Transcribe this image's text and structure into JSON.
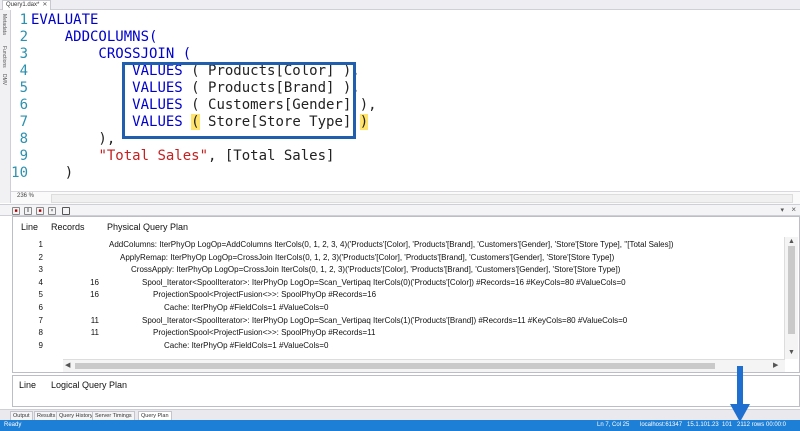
{
  "tab": {
    "title": "Query1.dax*",
    "close": "✕"
  },
  "rail": {
    "labels": [
      "Metadata",
      "Functions",
      "DMV"
    ]
  },
  "editor": {
    "zoom": "236 %",
    "lines": [
      {
        "n": "1",
        "parts": [
          {
            "t": "EVALUATE",
            "c": "kw"
          }
        ]
      },
      {
        "n": "2",
        "parts": [
          {
            "t": "    ADDCOLUMNS(",
            "c": "fn"
          }
        ]
      },
      {
        "n": "3",
        "parts": [
          {
            "t": "        CROSSJOIN (",
            "c": "fn"
          }
        ]
      },
      {
        "n": "4",
        "parts": [
          {
            "t": "            ",
            "c": "tx"
          },
          {
            "t": "VALUES",
            "c": "fn"
          },
          {
            "t": " ( Products[Color] ),",
            "c": "tx"
          }
        ]
      },
      {
        "n": "5",
        "parts": [
          {
            "t": "            ",
            "c": "tx"
          },
          {
            "t": "VALUES",
            "c": "fn"
          },
          {
            "t": " ( Products[Brand] ),",
            "c": "tx"
          }
        ]
      },
      {
        "n": "6",
        "parts": [
          {
            "t": "            ",
            "c": "tx"
          },
          {
            "t": "VALUES",
            "c": "fn"
          },
          {
            "t": " ( Customers[Gender] ),",
            "c": "tx"
          }
        ]
      },
      {
        "n": "7",
        "parts": [
          {
            "t": "            ",
            "c": "tx"
          },
          {
            "t": "VALUES",
            "c": "fn"
          },
          {
            "t": " ",
            "c": "tx"
          },
          {
            "t": "(",
            "c": "tx hl"
          },
          {
            "t": " Store[Store Type] ",
            "c": "tx"
          },
          {
            "t": ")",
            "c": "tx hl"
          }
        ]
      },
      {
        "n": "8",
        "parts": [
          {
            "t": "        ),",
            "c": "tx"
          }
        ]
      },
      {
        "n": "9",
        "parts": [
          {
            "t": "        ",
            "c": "tx"
          },
          {
            "t": "\"Total Sales\"",
            "c": "str"
          },
          {
            "t": ", [Total Sales]",
            "c": "tx"
          }
        ]
      },
      {
        "n": "10",
        "parts": [
          {
            "t": "    )",
            "c": "tx"
          }
        ]
      }
    ]
  },
  "physical_plan": {
    "headers": {
      "line": "Line",
      "records": "Records",
      "plan": "Physical Query Plan"
    },
    "rows": [
      {
        "line": "1",
        "records": "",
        "indent": 0,
        "op": "AddColumns: IterPhyOp LogOp=AddColumns IterCols(0, 1, 2, 3, 4)('Products'[Color], 'Products'[Brand], 'Customers'[Gender], 'Store'[Store Type], ''[Total Sales])"
      },
      {
        "line": "2",
        "records": "",
        "indent": 1,
        "op": "ApplyRemap: IterPhyOp LogOp=CrossJoin IterCols(0, 1, 2, 3)('Products'[Color], 'Products'[Brand], 'Customers'[Gender], 'Store'[Store Type])"
      },
      {
        "line": "3",
        "records": "",
        "indent": 2,
        "op": "CrossApply: IterPhyOp LogOp=CrossJoin IterCols(0, 1, 2, 3)('Products'[Color], 'Products'[Brand], 'Customers'[Gender], 'Store'[Store Type])"
      },
      {
        "line": "4",
        "records": "16",
        "indent": 3,
        "op": "Spool_Iterator<SpoolIterator>: IterPhyOp LogOp=Scan_Vertipaq IterCols(0)('Products'[Color]) #Records=16 #KeyCols=80 #ValueCols=0"
      },
      {
        "line": "5",
        "records": "16",
        "indent": 4,
        "op": "ProjectionSpool<ProjectFusion<>>: SpoolPhyOp #Records=16"
      },
      {
        "line": "6",
        "records": "",
        "indent": 5,
        "op": "Cache: IterPhyOp #FieldCols=1 #ValueCols=0"
      },
      {
        "line": "7",
        "records": "11",
        "indent": 3,
        "op": "Spool_Iterator<SpoolIterator>: IterPhyOp LogOp=Scan_Vertipaq IterCols(1)('Products'[Brand]) #Records=11 #KeyCols=80 #ValueCols=0"
      },
      {
        "line": "8",
        "records": "11",
        "indent": 4,
        "op": "ProjectionSpool<ProjectFusion<>>: SpoolPhyOp #Records=11"
      },
      {
        "line": "9",
        "records": "",
        "indent": 5,
        "op": "Cache: IterPhyOp #FieldCols=1 #ValueCols=0"
      }
    ]
  },
  "logical_plan": {
    "headers": {
      "line": "Line",
      "plan": "Logical Query Plan"
    }
  },
  "bottom_tabs": [
    "Output",
    "Results",
    "Query History",
    "Server Timings",
    "Query Plan"
  ],
  "statusbar": {
    "ready": "Ready",
    "position": "Ln 7, Col 25",
    "server": "localhost:61347",
    "version": "15.1.101.23",
    "spid": "101",
    "rows": "2112 rows",
    "time": "00:00:0"
  },
  "colors": {
    "accent": "#1e7fd6",
    "highlight_box": "#1f5fad",
    "keyword": "#0000cc",
    "string": "#c42020"
  }
}
